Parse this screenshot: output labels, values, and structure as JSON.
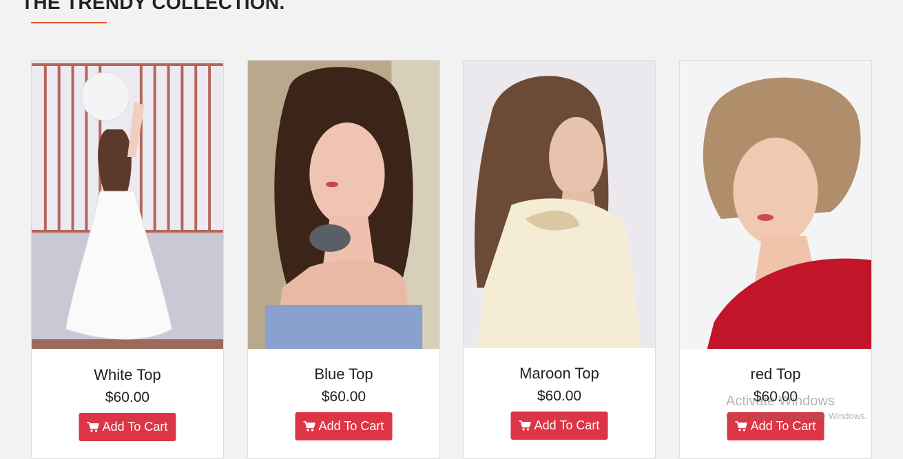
{
  "section": {
    "title": "THE TRENDY COLLECTION.",
    "accent_color": "#e4572e"
  },
  "products": [
    {
      "name": "White Top",
      "price": "$60.00",
      "button_label": "Add To Cart",
      "button_icon": "shopping-cart-icon",
      "image": "woman-in-white-dress-holding-balloon"
    },
    {
      "name": "Blue Top",
      "price": "$60.00",
      "button_label": "Add To Cart",
      "button_icon": "shopping-cart-icon",
      "image": "woman-in-blue-top-with-necklace"
    },
    {
      "name": "Maroon Top",
      "price": "$60.00",
      "button_label": "Add To Cart",
      "button_icon": "shopping-cart-icon",
      "image": "woman-in-cream-blouse"
    },
    {
      "name": "red Top",
      "price": "$60.00",
      "button_label": "Add To Cart",
      "button_icon": "shopping-cart-icon",
      "image": "woman-in-red-top-curly-hair"
    }
  ],
  "colors": {
    "button": "#dc3545",
    "background": "#f2f2f2"
  },
  "watermark": {
    "title": "Activate Windows",
    "subtitle": "Go to Settings to activate Windows."
  }
}
